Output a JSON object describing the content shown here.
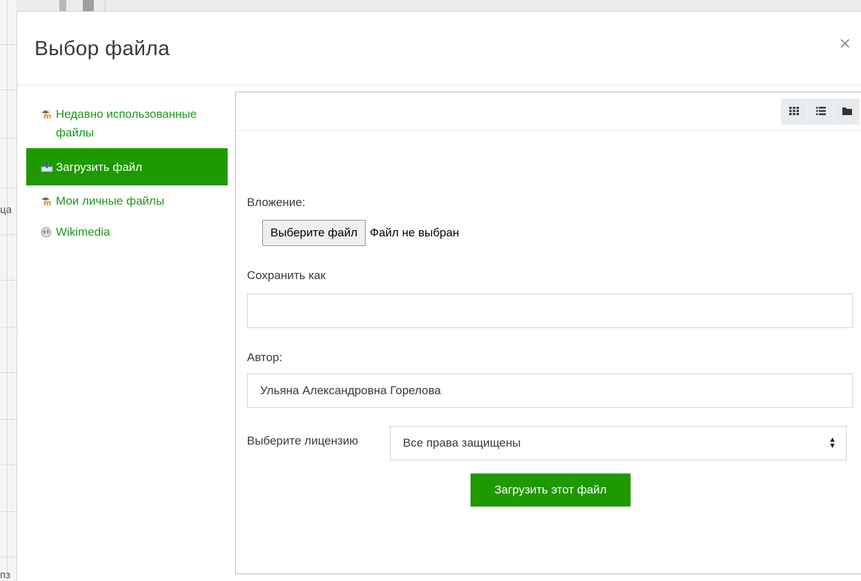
{
  "background": {
    "fragments": [
      "ца",
      "пз"
    ]
  },
  "modal": {
    "title": "Выбор файла",
    "close_label": "×"
  },
  "sidebar": {
    "items": [
      {
        "label": "Недавно использованные файлы",
        "icon": "moodle-icon",
        "active": false
      },
      {
        "label": "Загрузить файл",
        "icon": "upload-icon",
        "active": true
      },
      {
        "label": "Мои личные файлы",
        "icon": "moodle-icon",
        "active": false
      },
      {
        "label": "Wikimedia",
        "icon": "wikimedia-icon",
        "active": false
      }
    ]
  },
  "toolbar": {
    "views": [
      {
        "name": "grid-view",
        "icon": "grid-icon"
      },
      {
        "name": "list-view",
        "icon": "list-icon"
      },
      {
        "name": "tree-view",
        "icon": "folder-icon"
      }
    ]
  },
  "form": {
    "attachment_label": "Вложение:",
    "choose_file_label": "Выберите файл",
    "file_status": "Файл не выбран",
    "saveas_label": "Сохранить как",
    "saveas_value": "",
    "author_label": "Автор:",
    "author_value": "Ульяна Александровна Горелова",
    "license_label": "Выберите лицензию",
    "license_value": "Все права защищены",
    "upload_label": "Загрузить этот файл"
  },
  "colors": {
    "accent": "#1f9900",
    "link": "#1a9a1a",
    "moodle_orange": "#f98012"
  }
}
